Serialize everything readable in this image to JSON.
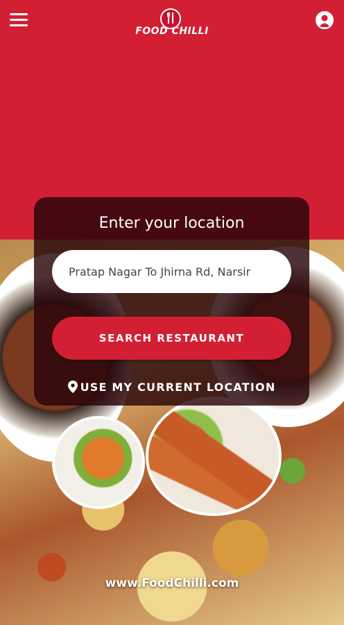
{
  "header": {
    "menu_icon": "hamburger-menu-icon",
    "logo_text": "FOOD CHILLI",
    "profile_icon": "user-profile-icon"
  },
  "location_card": {
    "title": "Enter your location",
    "input_value": "Pratap Nagar To Jhirna Rd, Narsir",
    "search_button_label": "SEARCH RESTAURANT",
    "current_location_label": "USE MY CURRENT LOCATION",
    "pin_icon": "location-pin-icon"
  },
  "footer": {
    "url": "www.FoodChilli.com"
  },
  "colors": {
    "brand_red": "#d21f34",
    "card_overlay": "#28050a"
  }
}
